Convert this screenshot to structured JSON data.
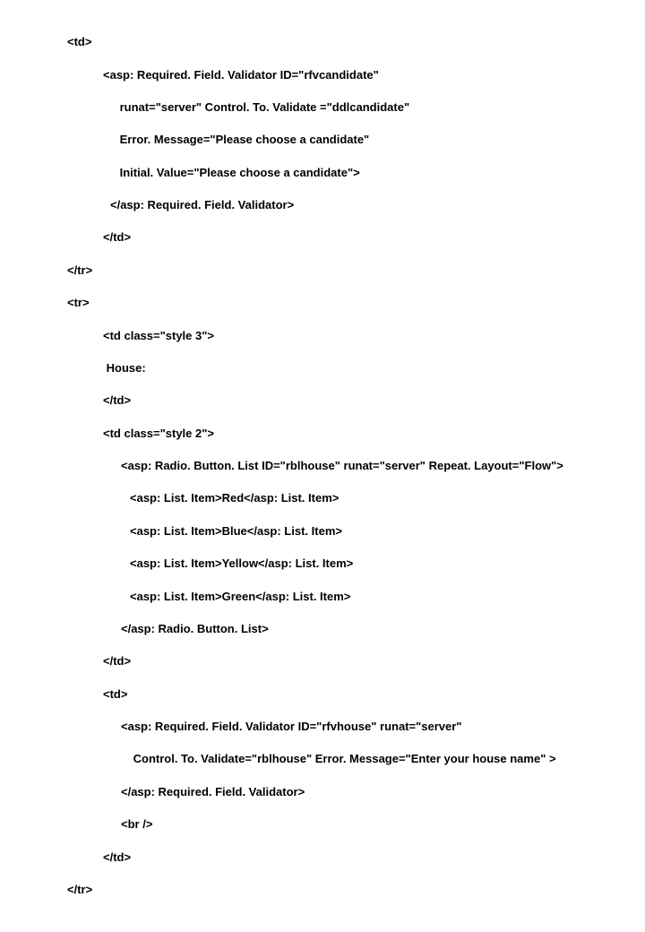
{
  "code": {
    "l01": "<td>",
    "l02": "<asp: Required. Field. Validator ID=\"rfvcandidate\"",
    "l03": " runat=\"server\" Control. To. Validate =\"ddlcandidate\"",
    "l04": " Error. Message=\"Please choose a candidate\"",
    "l05": " Initial. Value=\"Please choose a candidate\">",
    "l06": "</asp: Required. Field. Validator>",
    "l07": "</td>",
    "l08": "</tr>",
    "l09": "<tr>",
    "l10": "<td class=\"style 3\">",
    "l11": " House:",
    "l12": "</td>",
    "l13": "<td class=\"style 2\">",
    "l14": "<asp: Radio. Button. List ID=\"rblhouse\" runat=\"server\" Repeat. Layout=\"Flow\">",
    "l15": "<asp: List. Item>Red</asp: List. Item>",
    "l16": "<asp: List. Item>Blue</asp: List. Item>",
    "l17": "<asp: List. Item>Yellow</asp: List. Item>",
    "l18": "<asp: List. Item>Green</asp: List. Item>",
    "l19": "</asp: Radio. Button. List>",
    "l20": "</td>",
    "l21": "<td>",
    "l22": "<asp: Required. Field. Validator ID=\"rfvhouse\" runat=\"server\"",
    "l23": " Control. To. Validate=\"rblhouse\" Error. Message=\"Enter your house name\" >",
    "l24": "</asp: Required. Field. Validator>",
    "l25": "<br />",
    "l26": "</td>",
    "l27": "</tr>"
  }
}
